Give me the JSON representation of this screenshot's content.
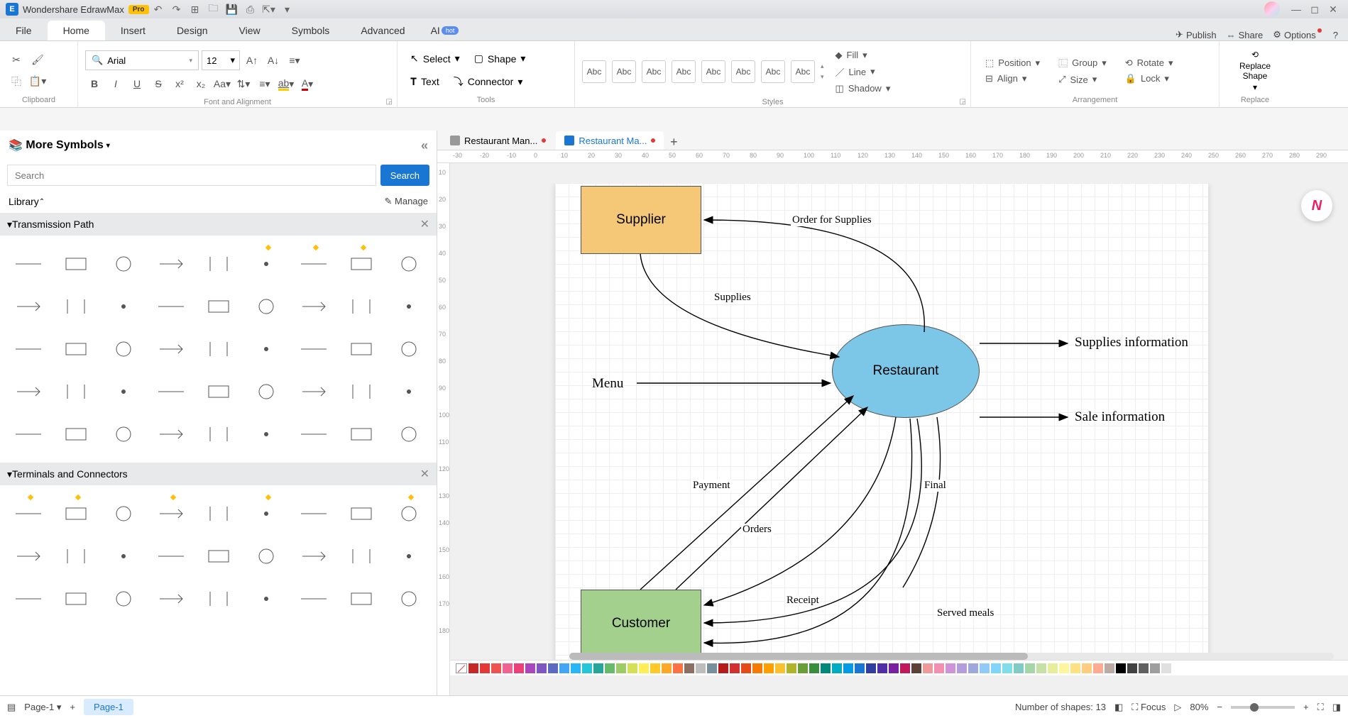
{
  "app": {
    "name": "Wondershare EdrawMax",
    "badge": "Pro"
  },
  "menu": {
    "items": [
      "File",
      "Home",
      "Insert",
      "Design",
      "View",
      "Symbols",
      "Advanced"
    ],
    "active": 1,
    "ai": "AI",
    "hot": "hot",
    "right": {
      "publish": "Publish",
      "share": "Share",
      "options": "Options"
    }
  },
  "ribbon": {
    "font": {
      "name": "Arial",
      "size": "12"
    },
    "tools": {
      "select": "Select",
      "text": "Text",
      "shape": "Shape",
      "connector": "Connector"
    },
    "style_box": "Abc",
    "format": {
      "fill": "Fill",
      "line": "Line",
      "shadow": "Shadow"
    },
    "arrange": {
      "position": "Position",
      "align": "Align",
      "group": "Group",
      "size": "Size",
      "rotate": "Rotate",
      "lock": "Lock"
    },
    "replace": "Replace Shape",
    "groups": {
      "clipboard": "Clipboard",
      "font": "Font and Alignment",
      "tools": "Tools",
      "styles": "Styles",
      "arrangement": "Arrangement",
      "replace": "Replace"
    }
  },
  "leftpanel": {
    "title": "More Symbols",
    "search_ph": "Search",
    "search_btn": "Search",
    "library": "Library",
    "manage": "Manage",
    "cat1": "Transmission Path",
    "cat2": "Terminals and Connectors"
  },
  "tabs": [
    {
      "label": "Restaurant Man...",
      "active": false
    },
    {
      "label": "Restaurant Ma...",
      "active": true
    }
  ],
  "ruler_h": [
    "-30",
    "-20",
    "-10",
    "0",
    "10",
    "20",
    "30",
    "40",
    "50",
    "60",
    "70",
    "80",
    "90",
    "100",
    "110",
    "120",
    "130",
    "140",
    "150",
    "160",
    "170",
    "180",
    "190",
    "200",
    "210",
    "220",
    "230",
    "240",
    "250",
    "260",
    "270",
    "280",
    "290"
  ],
  "ruler_v": [
    "10",
    "20",
    "30",
    "40",
    "50",
    "60",
    "70",
    "80",
    "90",
    "100",
    "110",
    "120",
    "130",
    "140",
    "150",
    "160",
    "170",
    "180"
  ],
  "diagram": {
    "supplier": "Supplier",
    "restaurant": "Restaurant",
    "customer": "Customer",
    "menu": "Menu",
    "supplies_info": "Supplies information",
    "sale_info": "Sale information",
    "edges": {
      "order": "Order for Supplies",
      "supplies": "Supplies",
      "payment": "Payment",
      "orders": "Orders",
      "final": "Final",
      "receipt": "Receipt",
      "served": "Served meals"
    }
  },
  "status": {
    "page": "Page-1",
    "page_active": "Page-1",
    "shapes": "Number of shapes: 13",
    "focus": "Focus",
    "zoom": "80%"
  },
  "colors": [
    "#c62828",
    "#e53935",
    "#ef5350",
    "#f06292",
    "#ec407a",
    "#ab47bc",
    "#7e57c2",
    "#5c6bc0",
    "#42a5f5",
    "#29b6f6",
    "#26c6da",
    "#26a69a",
    "#66bb6a",
    "#9ccc65",
    "#d4e157",
    "#ffee58",
    "#ffca28",
    "#ffa726",
    "#ff7043",
    "#8d6e63",
    "#bdbdbd",
    "#78909c",
    "#b71c1c",
    "#d32f2f",
    "#e64a19",
    "#f57c00",
    "#ffa000",
    "#fbc02d",
    "#afb42b",
    "#689f38",
    "#388e3c",
    "#00897b",
    "#00acc1",
    "#039be5",
    "#1976d2",
    "#303f9f",
    "#512da8",
    "#7b1fa2",
    "#c2185b",
    "#5d4037",
    "#ef9a9a",
    "#f48fb1",
    "#ce93d8",
    "#b39ddb",
    "#9fa8da",
    "#90caf9",
    "#81d4fa",
    "#80deea",
    "#80cbc4",
    "#a5d6a7",
    "#c5e1a5",
    "#e6ee9c",
    "#fff59d",
    "#ffe082",
    "#ffcc80",
    "#ffab91",
    "#bcaaa4",
    "#000",
    "#424242",
    "#616161",
    "#9e9e9e",
    "#e0e0e0",
    "#fff"
  ]
}
